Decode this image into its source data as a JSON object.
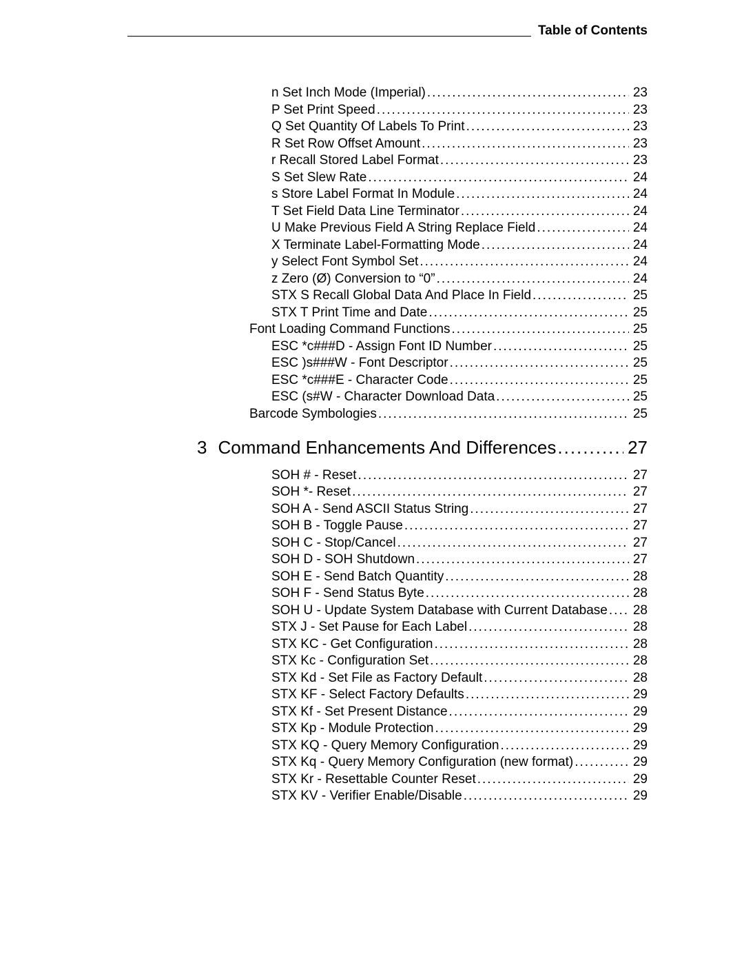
{
  "header": {
    "title": "Table of Contents"
  },
  "chapter": {
    "number": "3",
    "title": "Command Enhancements And Differences",
    "page": "27"
  },
  "pre": [
    {
      "lvl": 2,
      "label": "n Set Inch Mode (Imperial)",
      "page": "23"
    },
    {
      "lvl": 2,
      "label": "P Set Print Speed",
      "page": "23"
    },
    {
      "lvl": 2,
      "label": "Q Set Quantity Of Labels To Print",
      "page": "23"
    },
    {
      "lvl": 2,
      "label": "R Set Row Offset Amount",
      "page": "23"
    },
    {
      "lvl": 2,
      "label": "r Recall Stored Label Format",
      "page": "23"
    },
    {
      "lvl": 2,
      "label": "S Set Slew Rate",
      "page": "24"
    },
    {
      "lvl": 2,
      "label": "s Store Label Format In Module",
      "page": "24"
    },
    {
      "lvl": 2,
      "label": "T Set Field Data Line Terminator",
      "page": "24"
    },
    {
      "lvl": 2,
      "label": "U Make Previous Field A String Replace Field",
      "page": "24"
    },
    {
      "lvl": 2,
      "label": "X Terminate Label-Formatting Mode",
      "page": "24"
    },
    {
      "lvl": 2,
      "label": "y Select Font Symbol Set",
      "page": "24"
    },
    {
      "lvl": 2,
      "label": "z Zero (Ø) Conversion to “0”",
      "page": "24"
    },
    {
      "lvl": 2,
      "label": "STX S Recall Global Data And Place In Field",
      "page": "25"
    },
    {
      "lvl": 2,
      "label": "STX T Print Time and Date",
      "page": "25"
    },
    {
      "lvl": 1,
      "label": "Font Loading Command Functions",
      "page": "25"
    },
    {
      "lvl": 2,
      "label": "ESC *c###D - Assign Font ID Number",
      "page": "25"
    },
    {
      "lvl": 2,
      "label": "ESC )s###W - Font Descriptor",
      "page": "25"
    },
    {
      "lvl": 2,
      "label": "ESC *c###E - Character Code",
      "page": "25"
    },
    {
      "lvl": 2,
      "label": "ESC (s#W - Character Download Data",
      "page": "25"
    },
    {
      "lvl": 1,
      "label": "Barcode Symbologies",
      "page": "25"
    }
  ],
  "post": [
    {
      "lvl": 2,
      "label": "SOH # - Reset",
      "page": "27"
    },
    {
      "lvl": 2,
      "label": "SOH *- Reset",
      "page": "27"
    },
    {
      "lvl": 2,
      "label": "SOH A - Send ASCII Status String",
      "page": "27"
    },
    {
      "lvl": 2,
      "label": "SOH B - Toggle Pause",
      "page": "27"
    },
    {
      "lvl": 2,
      "label": "SOH C - Stop/Cancel",
      "page": "27"
    },
    {
      "lvl": 2,
      "label": "SOH D - SOH Shutdown",
      "page": "27"
    },
    {
      "lvl": 2,
      "label": "SOH E - Send Batch Quantity",
      "page": "28"
    },
    {
      "lvl": 2,
      "label": "SOH F - Send Status Byte",
      "page": "28"
    },
    {
      "lvl": 2,
      "label": "SOH U - Update System Database with Current Database",
      "page": "28"
    },
    {
      "lvl": 2,
      "label": "STX J - Set Pause for Each Label",
      "page": "28"
    },
    {
      "lvl": 2,
      "label": "STX KC - Get Configuration",
      "page": "28"
    },
    {
      "lvl": 2,
      "label": "STX Kc - Configuration Set",
      "page": "28"
    },
    {
      "lvl": 2,
      "label": "STX Kd - Set File as Factory Default",
      "page": "28"
    },
    {
      "lvl": 2,
      "label": "STX KF - Select Factory Defaults",
      "page": "29"
    },
    {
      "lvl": 2,
      "label": "STX Kf - Set Present Distance",
      "page": "29"
    },
    {
      "lvl": 2,
      "label": "STX Kp - Module Protection",
      "page": "29"
    },
    {
      "lvl": 2,
      "label": "STX KQ - Query Memory Configuration",
      "page": "29"
    },
    {
      "lvl": 2,
      "label": "STX Kq - Query Memory Configuration (new format)",
      "page": "29"
    },
    {
      "lvl": 2,
      "label": "STX Kr - Resettable Counter Reset",
      "page": "29"
    },
    {
      "lvl": 2,
      "label": "STX KV - Verifier Enable/Disable",
      "page": "29"
    }
  ]
}
